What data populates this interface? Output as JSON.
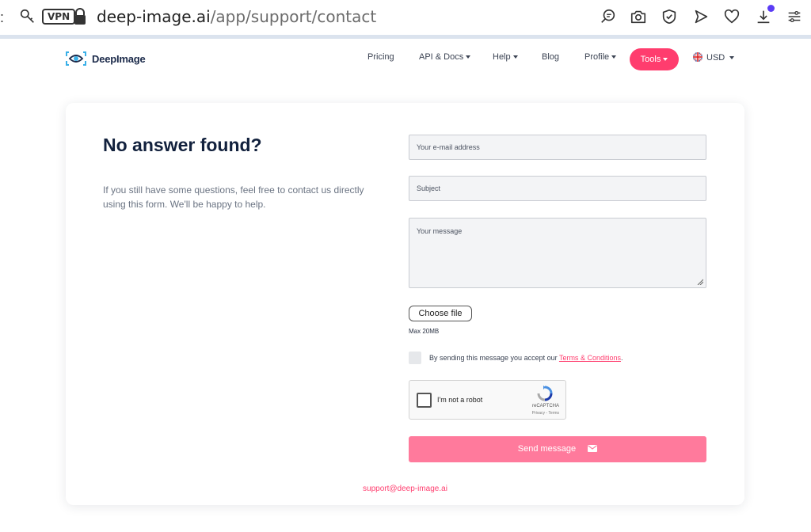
{
  "browser": {
    "vpn_label": "VPN",
    "url_domain": "deep-image.ai",
    "url_path": "/app/support/contact",
    "icons": [
      "key-icon",
      "lock-icon",
      "search-page-icon",
      "camera-icon",
      "shield-check-icon",
      "send-icon",
      "heart-icon",
      "download-icon",
      "menu-icon"
    ]
  },
  "header": {
    "logo_text": "DeepImage",
    "nav": {
      "pricing": "Pricing",
      "api_docs": "API & Docs",
      "help": "Help",
      "blog": "Blog",
      "profile": "Profile",
      "tools": "Tools",
      "currency": "USD"
    }
  },
  "contact": {
    "title": "No answer found?",
    "description": "If you still have some questions, feel free to contact us directly using this form. We'll be happy to help.",
    "email_placeholder": "Your e-mail address",
    "subject_placeholder": "Subject",
    "message_placeholder": "Your message",
    "choose_file_label": "Choose file",
    "max_size": "Max 20MB",
    "consent_prefix": "By sending this message you accept our ",
    "consent_link": "Terms & Conditions",
    "consent_suffix": ".",
    "recaptcha": {
      "label": "I'm not a robot",
      "brand": "reCAPTCHA",
      "terms": "Privacy - Terms"
    },
    "send_label": "Send message",
    "support_email": "support@deep-image.ai"
  },
  "colors": {
    "accent": "#ff3d6e",
    "send_button": "#ff7a9c",
    "heading": "#12213d"
  }
}
